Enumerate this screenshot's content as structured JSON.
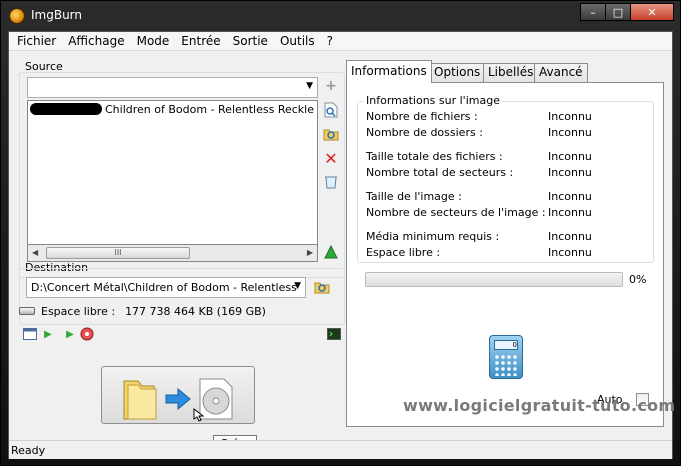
{
  "window": {
    "title": "ImgBurn",
    "minimize": "–",
    "maximize": "□",
    "close": "✕"
  },
  "menu": [
    "Fichier",
    "Affichage",
    "Mode",
    "Entrée",
    "Sortie",
    "Outils",
    "?"
  ],
  "source": {
    "label": "Source",
    "combo_value": "",
    "file_item": "Children of Bodom - Relentless Reckle",
    "scroll_glyph": "III"
  },
  "destination": {
    "label": "Destination",
    "path": "D:\\Concert Métal\\Children of Bodom - Relentless",
    "free_label": "Espace libre :",
    "free_value": "177 738 464 KB  (169 GB)"
  },
  "tabs": [
    {
      "label": "Informations",
      "active": true
    },
    {
      "label": "Options",
      "active": false
    },
    {
      "label": "Libellés",
      "active": false
    },
    {
      "label": "Avancé",
      "active": false
    }
  ],
  "info": {
    "title": "Informations sur l'image",
    "rows": [
      {
        "label": "Nombre de fichiers :",
        "value": "Inconnu"
      },
      {
        "label": "Nombre de dossiers :",
        "value": "Inconnu"
      },
      {
        "label": "Taille totale des fichiers :",
        "value": "Inconnu"
      },
      {
        "label": "Nombre total de secteurs :",
        "value": "Inconnu"
      },
      {
        "label": "Taille de l'image :",
        "value": "Inconnu"
      },
      {
        "label": "Nombre de secteurs de l'image :",
        "value": "Inconnu"
      },
      {
        "label": "Média minimum requis :",
        "value": "Inconnu"
      },
      {
        "label": "Espace libre :",
        "value": "Inconnu"
      }
    ],
    "progress_percent": 0,
    "progress_text": "0%",
    "calc_display": "0",
    "auto_label": "Auto",
    "auto_checked": false
  },
  "tooltip": "Créer",
  "status": "Ready",
  "watermark": "www.logicielgratuit-tuto.com",
  "icons": {
    "add": "plus-icon",
    "find": "search-file-icon",
    "browse": "folder-search-icon",
    "remove": "delete-x-icon",
    "clear": "recycle-bin-icon",
    "calc": "calculator-icon"
  },
  "colors": {
    "accent_green": "#3bb83b",
    "delete_red": "#d82020",
    "title_bg": "#202020"
  }
}
